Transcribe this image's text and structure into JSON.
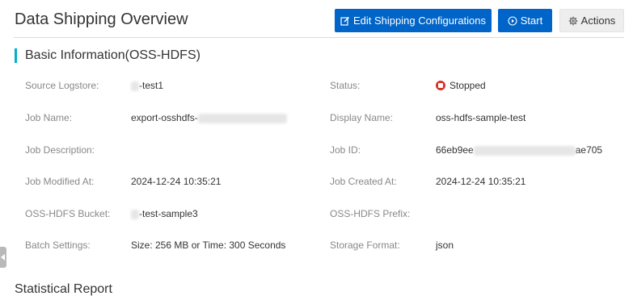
{
  "header": {
    "title": "Data Shipping Overview",
    "edit_label": "Edit Shipping Configurations",
    "start_label": "Start",
    "actions_label": "Actions"
  },
  "basic_info": {
    "title": "Basic Information(OSS-HDFS)",
    "fields": {
      "source_logstore": {
        "label": "Source Logstore:",
        "value": "-test1"
      },
      "status": {
        "label": "Status:",
        "value": "Stopped"
      },
      "job_name": {
        "label": "Job Name:",
        "value": "export-osshdfs-"
      },
      "display_name": {
        "label": "Display Name:",
        "value": "oss-hdfs-sample-test"
      },
      "job_description": {
        "label": "Job Description:",
        "value": ""
      },
      "job_id": {
        "label": "Job ID:",
        "value_prefix": "66eb9ee",
        "value_suffix": "ae705"
      },
      "job_modified_at": {
        "label": "Job Modified At:",
        "value": "2024-12-24 10:35:21"
      },
      "job_created_at": {
        "label": "Job Created At:",
        "value": "2024-12-24 10:35:21"
      },
      "oss_hdfs_bucket": {
        "label": "OSS-HDFS Bucket:",
        "value": "-test-sample3"
      },
      "oss_hdfs_prefix": {
        "label": "OSS-HDFS Prefix:",
        "value": ""
      },
      "batch_settings": {
        "label": "Batch Settings:",
        "value": "Size: 256 MB or Time: 300 Seconds"
      },
      "storage_format": {
        "label": "Storage Format:",
        "value": "json"
      }
    }
  },
  "statistical_report": {
    "title": "Statistical Report"
  },
  "colors": {
    "primary": "#0064c8",
    "section_accent": "#00b0c8",
    "status_stopped": "#d93026"
  },
  "icons": {
    "edit": "edit-icon",
    "start": "play-circle-icon",
    "actions": "gear-icon",
    "status": "stop-circle-icon",
    "side_tab": "collapse-arrow-icon"
  }
}
